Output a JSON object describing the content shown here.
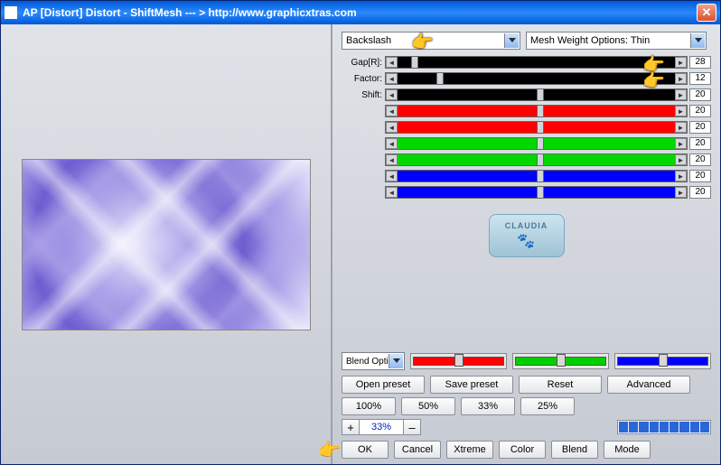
{
  "titlebar": {
    "text": "AP [Distort]  Distort - ShiftMesh     --- > http://www.graphicxtras.com"
  },
  "dropdowns": {
    "shape": "Backslash",
    "mesh": "Mesh Weight Options: Thin",
    "blend": "Blend Opti"
  },
  "sliders": [
    {
      "label": "Gap[R]:",
      "color": "black",
      "value": "28",
      "thumb": 5
    },
    {
      "label": "Factor:",
      "color": "black",
      "value": "12",
      "thumb": 14
    },
    {
      "label": "Shift:",
      "color": "black",
      "value": "20",
      "thumb": 50
    },
    {
      "label": "",
      "color": "red",
      "value": "20",
      "thumb": 50
    },
    {
      "label": "",
      "color": "red",
      "value": "20",
      "thumb": 50
    },
    {
      "label": "",
      "color": "green",
      "value": "20",
      "thumb": 50
    },
    {
      "label": "",
      "color": "green",
      "value": "20",
      "thumb": 50
    },
    {
      "label": "",
      "color": "blue",
      "value": "20",
      "thumb": 50
    },
    {
      "label": "",
      "color": "blue",
      "value": "20",
      "thumb": 50
    }
  ],
  "badge": {
    "text": "CLAUDIA"
  },
  "presetRow": {
    "open": "Open preset",
    "save": "Save preset",
    "reset": "Reset",
    "advanced": "Advanced"
  },
  "pctRow": {
    "p100": "100%",
    "p50": "50%",
    "p33": "33%",
    "p25": "25%"
  },
  "zoom": {
    "plus": "+",
    "value": "33%",
    "minus": "–"
  },
  "bottom": {
    "ok": "OK",
    "cancel": "Cancel",
    "xtreme": "Xtreme",
    "color": "Color",
    "blend": "Blend",
    "mode": "Mode"
  }
}
